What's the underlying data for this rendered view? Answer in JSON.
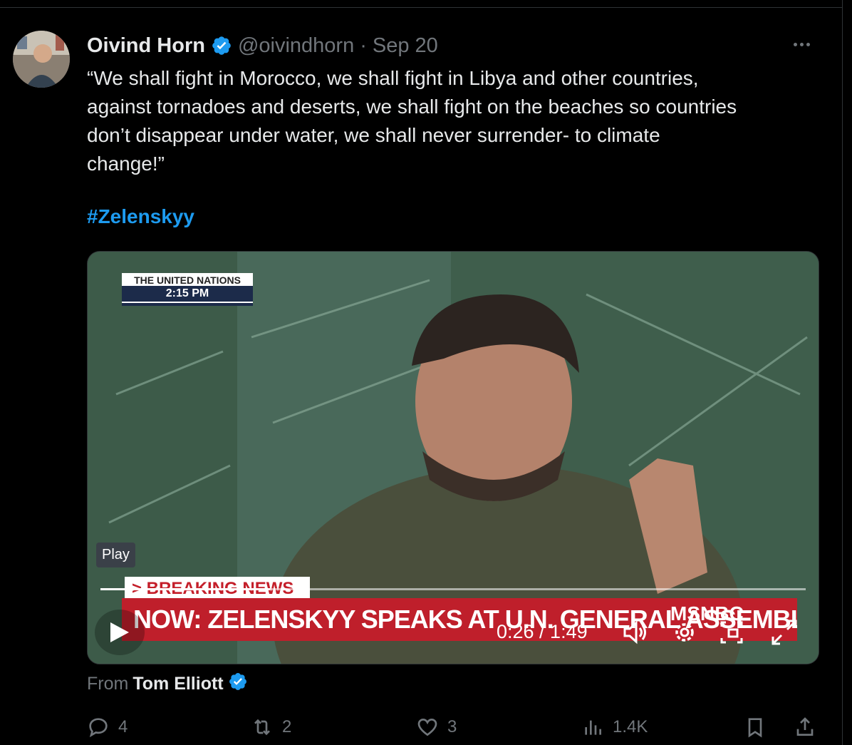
{
  "tweet": {
    "author_name": "Oivind Horn",
    "handle": "@oivindhorn",
    "separator": "·",
    "date": "Sep 20",
    "text": "“We shall fight in Morocco, we shall fight in Libya and other countries,\nagainst tornadoes and deserts, we shall fight on the beaches so countries\ndon’t disappear under water, we shall never surrender-  to climate\nchange!”",
    "hashtag": "#Zelenskyy"
  },
  "video": {
    "location_label": "THE UNITED NATIONS",
    "location_time": "2:15 PM",
    "breaking_label": "> BREAKING NEWS",
    "headline": "NOW: ZELENSKYY SPEAKS AT U.N. GENERAL ASSEMBLY",
    "network": "MSNBC",
    "play_tooltip": "Play",
    "current_time": "0:26",
    "duration": "1:49",
    "time_display": "0:26 / 1:49",
    "progress_fraction": 0.24
  },
  "attribution": {
    "prefix": "From",
    "name": "Tom Elliott"
  },
  "metrics": {
    "replies": "4",
    "reposts": "2",
    "likes": "3",
    "views": "1.4K"
  },
  "icons": {
    "verified": "verified-badge-icon",
    "more": "more-icon",
    "reply": "reply-icon",
    "repost": "repost-icon",
    "like": "like-icon",
    "views": "views-icon",
    "bookmark": "bookmark-icon",
    "share": "share-icon"
  },
  "colors": {
    "accent": "#1d9bf0",
    "muted": "#71767b",
    "text": "#e7e9ea",
    "banner_red": "#bf1f2b"
  }
}
